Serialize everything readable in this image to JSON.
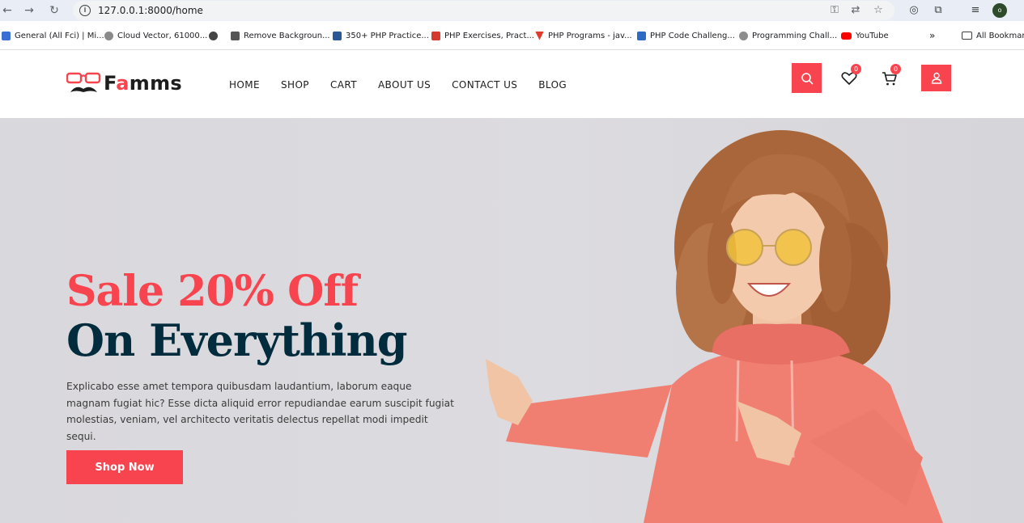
{
  "browser": {
    "url": "127.0.0.1:8000/home",
    "profile_initial": "o",
    "bookmarks": [
      {
        "label": "General (All Fci) | Mi...",
        "color": "#3b6fd4"
      },
      {
        "label": "Cloud Vector, 61000...",
        "color": "#8a8a8a"
      },
      {
        "label": "",
        "color": "#444444"
      },
      {
        "label": "Remove Backgroun...",
        "color": "#555555"
      },
      {
        "label": "350+ PHP Practice...",
        "color": "#2b5797"
      },
      {
        "label": "PHP Exercises, Pract...",
        "color": "#d63a2f"
      },
      {
        "label": "PHP Programs - jav...",
        "color": "#e03b2f"
      },
      {
        "label": "PHP Code Challeng...",
        "color": "#2f6bc4"
      },
      {
        "label": "Programming Chall...",
        "color": "#8d8d8d"
      },
      {
        "label": "YouTube",
        "color": "#ff0000"
      }
    ],
    "overflow": "»",
    "all_bookmarks": "All Bookmarks"
  },
  "site": {
    "logo_prefix": "F",
    "logo_accent": "a",
    "logo_suffix": "mms",
    "nav": [
      "HOME",
      "SHOP",
      "CART",
      "ABOUT US",
      "CONTACT US",
      "BLOG"
    ],
    "wishlist_count": "0",
    "cart_count": "0",
    "accent_color": "#f7444e",
    "dark_color": "#002c3e"
  },
  "hero": {
    "line1": "Sale 20% Off",
    "line2": "On Everything",
    "description": "Explicabo esse amet tempora quibusdam laudantium, laborum eaque magnam fugiat hic? Esse dicta aliquid error repudiandae earum suscipit fugiat molestias, veniam, vel architecto veritatis delectus repellat modi impedit sequi.",
    "cta": "Shop Now"
  }
}
